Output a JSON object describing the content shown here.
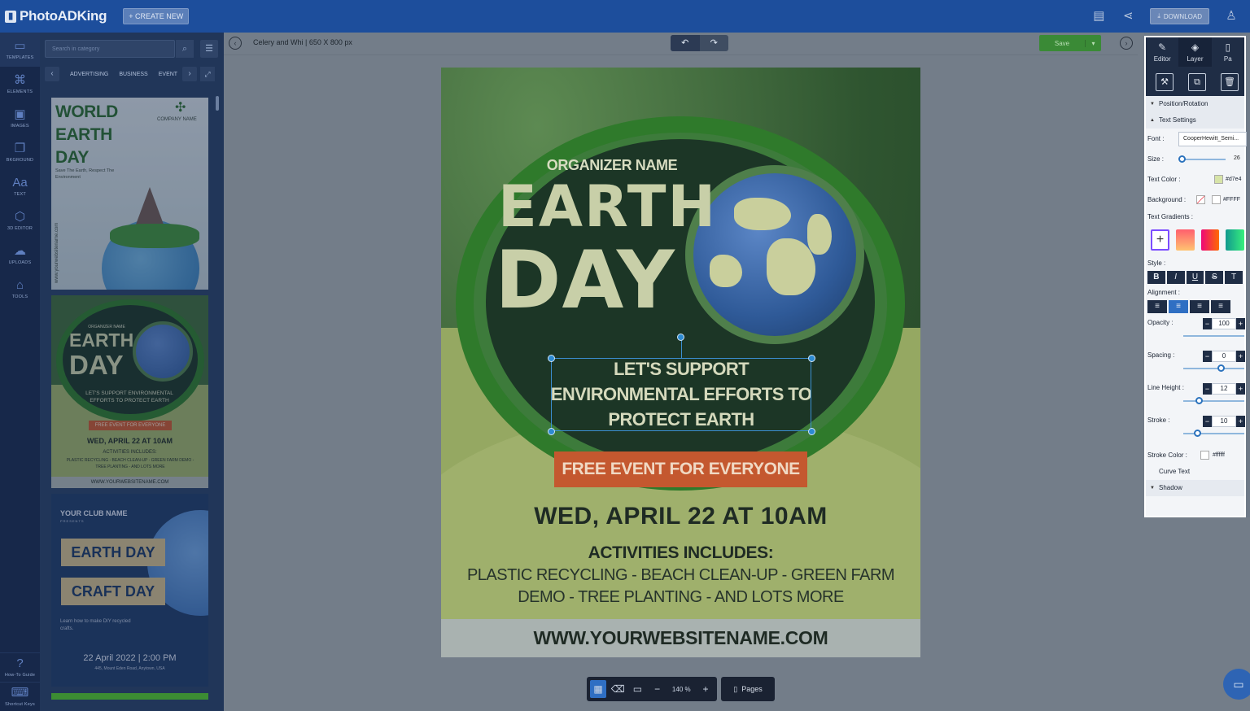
{
  "app": {
    "logo": "PhotoADKing",
    "create_new": "+ CREATE NEW",
    "download": "DOWNLOAD"
  },
  "sidebar": {
    "items": [
      {
        "label": "TEMPLATES",
        "icon": "templates-icon"
      },
      {
        "label": "ELEMENTS",
        "icon": "elements-icon"
      },
      {
        "label": "IMAGES",
        "icon": "images-icon"
      },
      {
        "label": "BKGROUND",
        "icon": "background-icon"
      },
      {
        "label": "TEXT",
        "icon": "text-icon"
      },
      {
        "label": "3D EDITOR",
        "icon": "3d-editor-icon"
      },
      {
        "label": "UPLOADS",
        "icon": "uploads-icon"
      },
      {
        "label": "TOOLS",
        "icon": "tools-icon"
      }
    ],
    "bottom": [
      {
        "label": "How-To Guide",
        "icon": "guide-icon"
      },
      {
        "label": "Shortcut Keys",
        "icon": "keyboard-icon"
      }
    ]
  },
  "panel": {
    "search_placeholder": "Search in category",
    "categories": [
      "ADVERTISING",
      "BUSINESS",
      "EVENT"
    ],
    "thumb1": {
      "title1": "WORLD",
      "title2": "EARTH",
      "title3": "DAY",
      "company": "COMPANY NAME",
      "sub": "Save The Earth, Respect The Environment",
      "side": "www.yourwebsitename.com"
    },
    "thumb2": {
      "org": "ORGANIZER NAME",
      "earth": "EARTH",
      "day": "DAY",
      "support": "LET'S SUPPORT ENVIRONMENTAL EFFORTS TO PROTECT EARTH",
      "free": "FREE EVENT FOR EVERYONE",
      "date": "WED, APRIL 22 AT 10AM",
      "act": "ACTIVITIES INCLUDES:",
      "list": "PLASTIC RECYCLING - BEACH CLEAN-UP - GREEN FARM DEMO - TREE PLANTING - AND LOTS MORE",
      "web": "WWW.YOURWEBSITENAME.COM"
    },
    "thumb3": {
      "club": "YOUR CLUB NAME",
      "presents": "PRESENTS",
      "b1": "EARTH DAY",
      "b2": "CRAFT DAY",
      "learn": "Learn how to make DIY recycled crafts.",
      "date": "22 April 2022 | 2:00 PM",
      "addr": "445, Mount Eden Road, Anytown, USA"
    }
  },
  "workspace": {
    "doc_title": "Celery and Whi | 650 X 800 px",
    "save": "Save",
    "zoom": "140 %",
    "pages": "Pages"
  },
  "poster": {
    "organizer": "ORGANIZER NAME",
    "earth": "EARTH",
    "day": "DAY",
    "support1": "LET'S SUPPORT",
    "support2": "ENVIRONMENTAL EFFORTS TO",
    "support3": "PROTECT EARTH",
    "free": "FREE EVENT FOR EVERYONE",
    "date": "WED, APRIL 22 AT 10AM",
    "activities": "ACTIVITIES INCLUDES:",
    "list1": "PLASTIC RECYCLING - BEACH CLEAN-UP - GREEN FARM",
    "list2": "DEMO - TREE PLANTING - AND LOTS MORE",
    "website": "WWW.YOURWEBSITENAME.COM"
  },
  "right_panel": {
    "tabs": [
      "Editor",
      "Layer",
      "Pa"
    ],
    "sections": {
      "position": "Position/Rotation",
      "text": "Text Settings",
      "curve": "Curve Text",
      "shadow": "Shadow"
    },
    "font_label": "Font :",
    "font_value": "CooperHewitt_Semi...",
    "size_label": "Size :",
    "size_value": "26",
    "text_color_label": "Text Color :",
    "text_color_value": "#d7e4",
    "background_label": "Background :",
    "background_value": "#FFFF",
    "gradients_label": "Text Gradients :",
    "style_label": "Style :",
    "alignment_label": "Alignment :",
    "opacity_label": "Opacity :",
    "opacity_value": "100",
    "spacing_label": "Spacing :",
    "spacing_value": "0",
    "lineheight_label": "Line Height :",
    "lineheight_value": "12",
    "stroke_label": "Stroke :",
    "stroke_value": "10",
    "stroke_color_label": "Stroke Color :",
    "stroke_color_value": "#ffffff"
  }
}
